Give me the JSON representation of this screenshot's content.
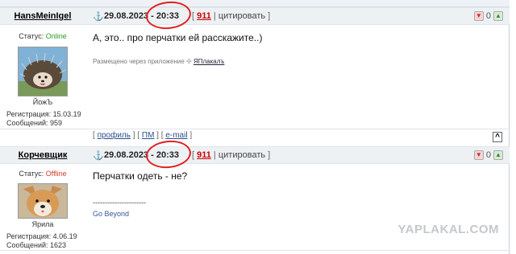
{
  "posts": [
    {
      "nick": "HansMeinIgel",
      "datetime": "29.08.2023 - 20:33",
      "links": {
        "num": "911",
        "quote": "цитировать"
      },
      "status_label": "Статус: ",
      "status_value": "Online",
      "status_color": "#2a9a2a",
      "avatar_caption": "ЙожЪ",
      "reg": "Регистрация: 15.03.19",
      "msgs": "Сообщений: 959",
      "message": "А, это.. про перчатки ей расскажите..)",
      "via_prefix": "Размещено через приложение",
      "via_app": "ЯПлакалъ",
      "vote_count": "0"
    },
    {
      "nick": "Корчевщик",
      "datetime": "29.08.2023 - 20:33",
      "links": {
        "num": "911",
        "quote": "цитировать"
      },
      "status_label": "Статус: ",
      "status_value": "Offline",
      "status_color": "#d23a2a",
      "avatar_caption": "Ярила",
      "reg": "Регистрация: 4.06.19",
      "msgs": "Сообщений: 1623",
      "message": "Перчатки одеть - не?",
      "signature_sep": "----------------------",
      "signature": "Go Beyond",
      "vote_count": "0"
    }
  ],
  "footer": {
    "profile": "профиль",
    "pm": "ПМ",
    "email": "e-mail",
    "totop": "^"
  },
  "watermark": "YAPLAKAL.COM"
}
